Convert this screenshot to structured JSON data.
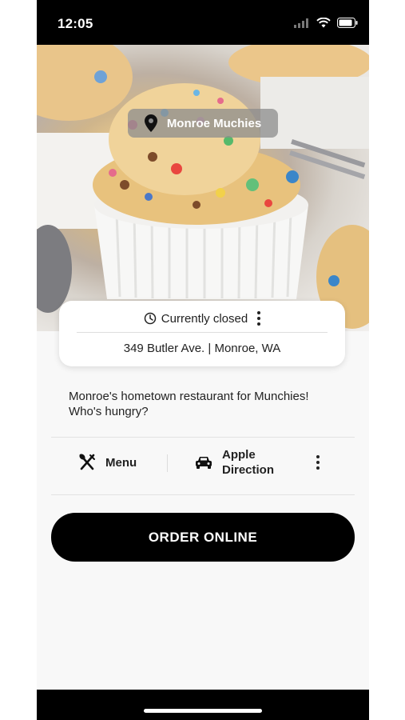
{
  "status_bar": {
    "time": "12:05"
  },
  "location": {
    "name": "Monroe Muchies"
  },
  "info": {
    "status": "Currently closed",
    "address": "349 Butler Ave.  | Monroe, WA"
  },
  "description": "Monroe's hometown restaurant for Munchies! Who's hungry?",
  "actions": {
    "menu_label": "Menu",
    "direction_line1": "Apple",
    "direction_line2": "Direction"
  },
  "order_button": {
    "label": "ORDER ONLINE"
  },
  "colors": {
    "primary": "#000000",
    "background": "#f8f8f8",
    "text": "#222222"
  },
  "icons": [
    "location-pin-icon",
    "clock-icon",
    "utensils-icon",
    "car-icon",
    "more-vertical-icon"
  ]
}
